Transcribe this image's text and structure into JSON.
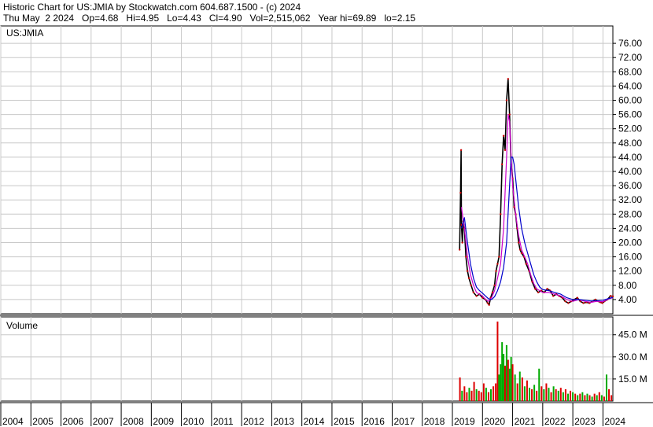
{
  "header": {
    "line1": "Historic Chart for US:JMIA by Stockwatch.com 604.687.1500 - (c) 2024",
    "line2": "Thu May  2 2024   Op=4.68   Hi=4.95   Lo=4.43   Cl=4.90   Vol=2,515,062   Year hi=69.89   lo=2.15"
  },
  "colors": {
    "grid": "#c8c8c8",
    "price": "#000000",
    "close_marker": "#cc0000",
    "ma_short": "#cc00cc",
    "ma_long": "#0000cc",
    "volume_up": "#00aa00",
    "volume_down": "#dd0000"
  },
  "chart_data": [
    {
      "type": "line",
      "symbol_label": "US:JMIA",
      "x_unit": "year",
      "ylim": [
        0,
        80
      ],
      "y_ticks": [
        "76.00",
        "72.00",
        "68.00",
        "64.00",
        "60.00",
        "56.00",
        "52.00",
        "48.00",
        "44.00",
        "40.00",
        "36.00",
        "32.00",
        "28.00",
        "24.00",
        "20.00",
        "16.00",
        "12.00",
        "8.00",
        "4.00"
      ],
      "grid": true,
      "series": [
        {
          "key": "price",
          "x": [
            2019.24,
            2019.27,
            2019.29,
            2019.3,
            2019.33,
            2019.36,
            2019.4,
            2019.45,
            2019.5,
            2019.55,
            2019.62,
            2019.7,
            2019.8,
            2019.9,
            2020.0,
            2020.1,
            2020.17,
            2020.22,
            2020.27,
            2020.33,
            2020.4,
            2020.45,
            2020.5,
            2020.55,
            2020.6,
            2020.65,
            2020.7,
            2020.75,
            2020.8,
            2020.85,
            2020.9,
            2020.95,
            2021.0,
            2021.05,
            2021.1,
            2021.15,
            2021.2,
            2021.25,
            2021.3,
            2021.38,
            2021.45,
            2021.55,
            2021.65,
            2021.75,
            2021.85,
            2021.95,
            2022.05,
            2022.15,
            2022.25,
            2022.35,
            2022.45,
            2022.55,
            2022.65,
            2022.75,
            2022.85,
            2022.95,
            2023.05,
            2023.15,
            2023.25,
            2023.35,
            2023.45,
            2023.55,
            2023.65,
            2023.75,
            2023.85,
            2023.92,
            2023.98,
            2024.05,
            2024.15,
            2024.25,
            2024.33
          ],
          "values": [
            18.0,
            34.0,
            46.0,
            25.0,
            20.0,
            26.0,
            24.0,
            16.0,
            12.0,
            10.0,
            8.0,
            6.0,
            5.0,
            5.5,
            4.5,
            4.0,
            3.0,
            2.5,
            4.5,
            6.0,
            8.0,
            12.0,
            14.0,
            16.0,
            28.0,
            42.0,
            50.0,
            46.0,
            60.0,
            66.0,
            56.0,
            42.0,
            38.0,
            30.0,
            28.0,
            24.0,
            20.0,
            18.0,
            17.0,
            16.0,
            14.0,
            12.0,
            9.0,
            7.0,
            6.0,
            6.5,
            6.0,
            7.0,
            6.5,
            5.0,
            5.5,
            5.0,
            4.5,
            3.5,
            3.0,
            3.5,
            4.0,
            4.5,
            3.5,
            3.0,
            3.2,
            3.0,
            3.5,
            4.0,
            3.5,
            3.2,
            3.0,
            3.5,
            4.0,
            5.0,
            4.9
          ]
        },
        {
          "key": "ma_short",
          "x": [
            2019.3,
            2019.4,
            2019.5,
            2019.6,
            2019.7,
            2019.8,
            2019.9,
            2020.0,
            2020.1,
            2020.2,
            2020.3,
            2020.4,
            2020.5,
            2020.6,
            2020.7,
            2020.8,
            2020.85,
            2020.9,
            2020.95,
            2021.0,
            2021.1,
            2021.2,
            2021.3,
            2021.4,
            2021.5,
            2021.6,
            2021.7,
            2021.8,
            2021.9,
            2022.0,
            2022.2,
            2022.4,
            2022.6,
            2022.8,
            2023.0,
            2023.2,
            2023.4,
            2023.6,
            2023.8,
            2024.0,
            2024.2,
            2024.33
          ],
          "values": [
            30.0,
            24.0,
            16.0,
            11.0,
            8.0,
            6.0,
            5.5,
            5.0,
            4.0,
            3.5,
            4.5,
            6.5,
            10.0,
            14.0,
            24.0,
            44.0,
            56.0,
            54.0,
            44.0,
            36.0,
            28.0,
            22.0,
            18.0,
            16.0,
            14.0,
            11.0,
            8.5,
            7.0,
            6.5,
            6.0,
            6.0,
            5.5,
            5.0,
            4.0,
            3.5,
            4.0,
            3.5,
            3.2,
            3.5,
            3.4,
            4.2,
            4.5
          ]
        },
        {
          "key": "ma_long",
          "x": [
            2019.3,
            2019.4,
            2019.5,
            2019.6,
            2019.7,
            2019.8,
            2019.9,
            2020.0,
            2020.1,
            2020.2,
            2020.3,
            2020.4,
            2020.5,
            2020.6,
            2020.7,
            2020.8,
            2020.9,
            2020.95,
            2021.0,
            2021.05,
            2021.1,
            2021.2,
            2021.3,
            2021.4,
            2021.5,
            2021.6,
            2021.7,
            2021.8,
            2021.9,
            2022.0,
            2022.2,
            2022.4,
            2022.6,
            2022.8,
            2023.0,
            2023.2,
            2023.4,
            2023.6,
            2023.8,
            2024.0,
            2024.2,
            2024.33
          ],
          "values": [
            24.0,
            27.0,
            20.0,
            14.0,
            10.0,
            7.5,
            6.5,
            5.8,
            5.0,
            4.2,
            4.0,
            4.8,
            6.5,
            9.0,
            13.0,
            20.0,
            36.0,
            44.0,
            44.0,
            42.0,
            38.0,
            30.0,
            24.0,
            20.0,
            17.0,
            14.0,
            11.0,
            9.0,
            7.5,
            6.8,
            6.5,
            6.0,
            5.5,
            4.5,
            4.0,
            4.0,
            3.8,
            3.6,
            3.7,
            3.8,
            4.3,
            4.6
          ]
        }
      ]
    },
    {
      "type": "bar",
      "panel_label": "Volume",
      "ylim": [
        0,
        55
      ],
      "y_ticks": [
        "45.0 M",
        "30.0 M",
        "15.0 M"
      ],
      "y_tick_values": [
        45,
        30,
        15
      ],
      "x": [
        2019.25,
        2019.32,
        2019.4,
        2019.48,
        2019.56,
        2019.64,
        2019.72,
        2019.8,
        2019.88,
        2019.96,
        2020.04,
        2020.12,
        2020.2,
        2020.28,
        2020.36,
        2020.44,
        2020.5,
        2020.55,
        2020.6,
        2020.65,
        2020.7,
        2020.75,
        2020.8,
        2020.85,
        2020.9,
        2020.95,
        2021.0,
        2021.08,
        2021.16,
        2021.24,
        2021.32,
        2021.4,
        2021.48,
        2021.56,
        2021.64,
        2021.72,
        2021.8,
        2021.88,
        2021.96,
        2022.04,
        2022.12,
        2022.2,
        2022.28,
        2022.36,
        2022.44,
        2022.52,
        2022.6,
        2022.68,
        2022.76,
        2022.84,
        2022.92,
        2023.0,
        2023.08,
        2023.16,
        2023.24,
        2023.32,
        2023.4,
        2023.48,
        2023.56,
        2023.64,
        2023.72,
        2023.8,
        2023.88,
        2023.96,
        2024.04,
        2024.12,
        2024.2,
        2024.28
      ],
      "values": [
        16,
        7,
        10,
        6,
        9,
        7,
        13,
        8,
        7,
        6,
        12,
        9,
        6,
        8,
        10,
        12,
        54,
        18,
        25,
        40,
        32,
        24,
        38,
        28,
        22,
        30,
        25,
        18,
        12,
        20,
        16,
        10,
        14,
        9,
        8,
        11,
        7,
        22,
        10,
        8,
        12,
        9,
        6,
        10,
        8,
        7,
        9,
        6,
        8,
        5,
        7,
        6,
        5,
        4,
        5,
        6,
        4,
        5,
        4,
        3,
        5,
        4,
        6,
        4,
        3,
        18,
        8,
        4
      ],
      "up": [
        0,
        1,
        0,
        0,
        1,
        0,
        0,
        1,
        0,
        0,
        0,
        1,
        0,
        1,
        0,
        0,
        0,
        1,
        1,
        1,
        1,
        0,
        1,
        0,
        1,
        1,
        0,
        1,
        0,
        1,
        0,
        1,
        0,
        1,
        0,
        1,
        0,
        1,
        0,
        1,
        0,
        1,
        0,
        1,
        0,
        1,
        0,
        1,
        0,
        1,
        0,
        1,
        0,
        1,
        0,
        1,
        0,
        1,
        0,
        1,
        0,
        1,
        0,
        1,
        0,
        1,
        0,
        0
      ]
    }
  ],
  "x_axis": {
    "labels": [
      "2004",
      "2005",
      "2006",
      "2007",
      "2008",
      "2009",
      "2010",
      "2011",
      "2012",
      "2013",
      "2014",
      "2015",
      "2016",
      "2017",
      "2018",
      "2019",
      "2020",
      "2021",
      "2022",
      "2023",
      "2024"
    ],
    "range": [
      2004,
      2024.33
    ]
  }
}
